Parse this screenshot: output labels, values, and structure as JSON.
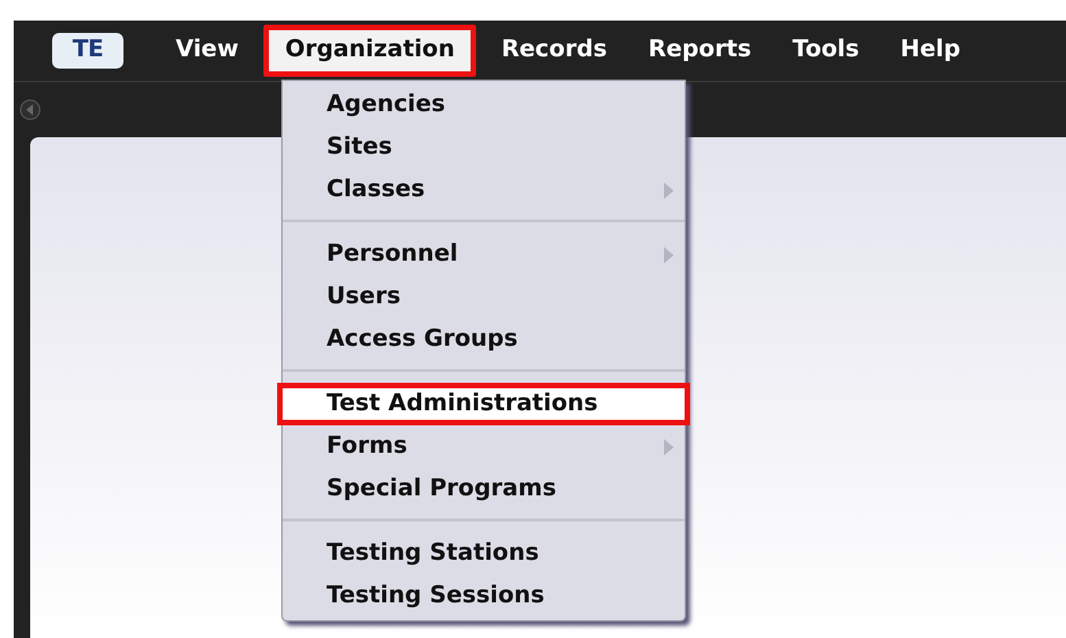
{
  "menubar": {
    "logo": "TE",
    "items": [
      {
        "label": "View",
        "selected": false
      },
      {
        "label": "Organization",
        "selected": true
      },
      {
        "label": "Records",
        "selected": false
      },
      {
        "label": "Reports",
        "selected": false
      },
      {
        "label": "Tools",
        "selected": false
      },
      {
        "label": "Help",
        "selected": false
      }
    ]
  },
  "menu": {
    "groups": [
      [
        {
          "label": "Agencies",
          "submenu": false,
          "selected": false
        },
        {
          "label": "Sites",
          "submenu": false,
          "selected": false
        },
        {
          "label": "Classes",
          "submenu": true,
          "selected": false
        }
      ],
      [
        {
          "label": "Personnel",
          "submenu": true,
          "selected": false
        },
        {
          "label": "Users",
          "submenu": false,
          "selected": false
        },
        {
          "label": "Access Groups",
          "submenu": false,
          "selected": false
        }
      ],
      [
        {
          "label": "Test Administrations",
          "submenu": false,
          "selected": true
        },
        {
          "label": "Forms",
          "submenu": true,
          "selected": false
        },
        {
          "label": "Special Programs",
          "submenu": false,
          "selected": false
        }
      ],
      [
        {
          "label": "Testing Stations",
          "submenu": false,
          "selected": false
        },
        {
          "label": "Testing Sessions",
          "submenu": false,
          "selected": false
        }
      ]
    ]
  }
}
